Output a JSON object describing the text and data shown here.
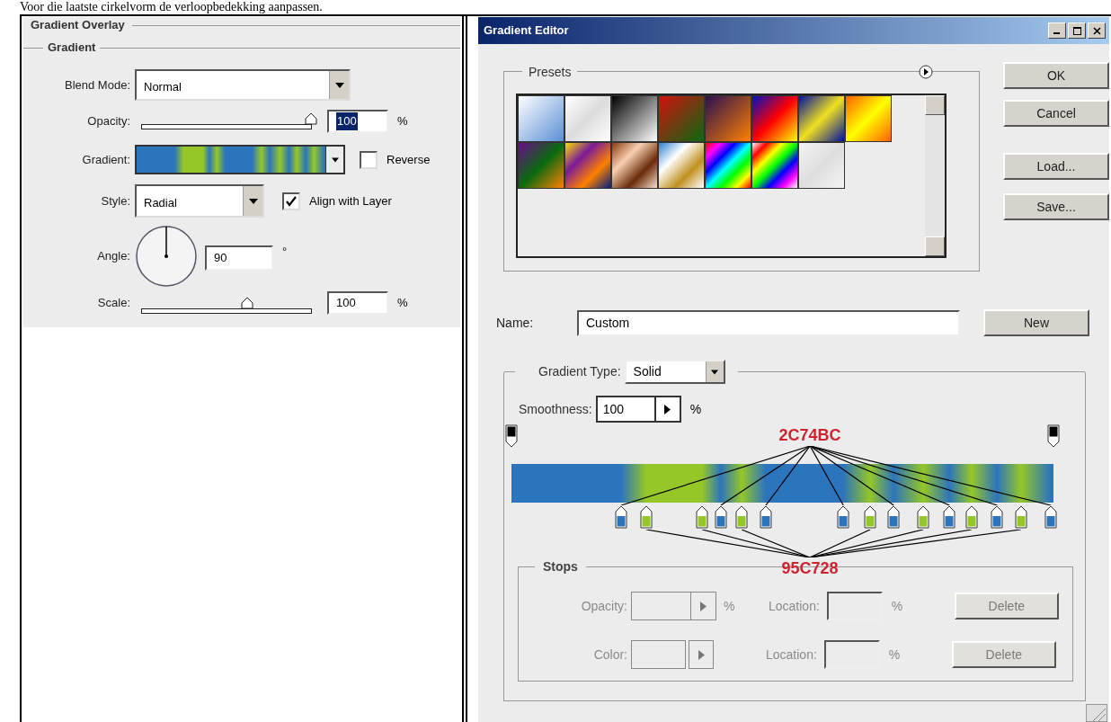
{
  "page_text": "Voor die laatste cirkelvorm de verloopbedekking aanpassen.",
  "layer_style": {
    "title": "Gradient Overlay",
    "section": "Gradient",
    "blend_mode": {
      "label": "Blend Mode:",
      "value": "Normal"
    },
    "opacity": {
      "label": "Opacity:",
      "value": "100",
      "unit": "%",
      "level": 1,
      "selected": true
    },
    "gradient": {
      "label": "Gradient:",
      "reverse": {
        "label": "Reverse",
        "checked": false
      }
    },
    "style": {
      "label": "Style:",
      "value": "Radial",
      "align": {
        "label": "Align with Layer",
        "checked": true
      }
    },
    "angle": {
      "label": "Angle:",
      "value": "90",
      "unit": "°"
    },
    "scale": {
      "label": "Scale:",
      "value": "100",
      "unit": "%",
      "level": 0.62
    }
  },
  "gradient_editor": {
    "title": "Gradient Editor",
    "presets_label": "Presets",
    "buttons": [
      "OK",
      "Cancel",
      "Load...",
      "Save..."
    ],
    "name": {
      "label": "Name:",
      "value": "Custom"
    },
    "new_button": "New",
    "gradient_type": {
      "label": "Gradient Type:",
      "value": "Solid"
    },
    "smoothness": {
      "label": "Smoothness:",
      "value": "100",
      "unit": "%"
    },
    "color_stops": [
      {
        "color": "#2c74bc"
      },
      {
        "color": "#95c728"
      },
      {
        "color": "#95c728"
      },
      {
        "color": "#2c74bc"
      },
      {
        "color": "#95c728"
      },
      {
        "color": "#2c74bc"
      },
      {
        "color": "#2c74bc"
      },
      {
        "color": "#95c728"
      },
      {
        "color": "#2c74bc"
      },
      {
        "color": "#95c728"
      },
      {
        "color": "#2c74bc"
      },
      {
        "color": "#95c728"
      },
      {
        "color": "#2c74bc"
      },
      {
        "color": "#95c728"
      },
      {
        "color": "#2c74bc"
      }
    ],
    "annotations": [
      {
        "text": "2C74BC",
        "kind": "above"
      },
      {
        "text": "95C728",
        "kind": "below"
      }
    ],
    "stops": {
      "label": "Stops",
      "rows": [
        {
          "label": "Opacity:",
          "unit": "%",
          "location_label": "Location:",
          "location_unit": "%",
          "button": "Delete",
          "disabled": true
        },
        {
          "label": "Color:",
          "location_label": "Location:",
          "location_unit": "%",
          "button": "Delete",
          "disabled": true
        }
      ]
    }
  }
}
